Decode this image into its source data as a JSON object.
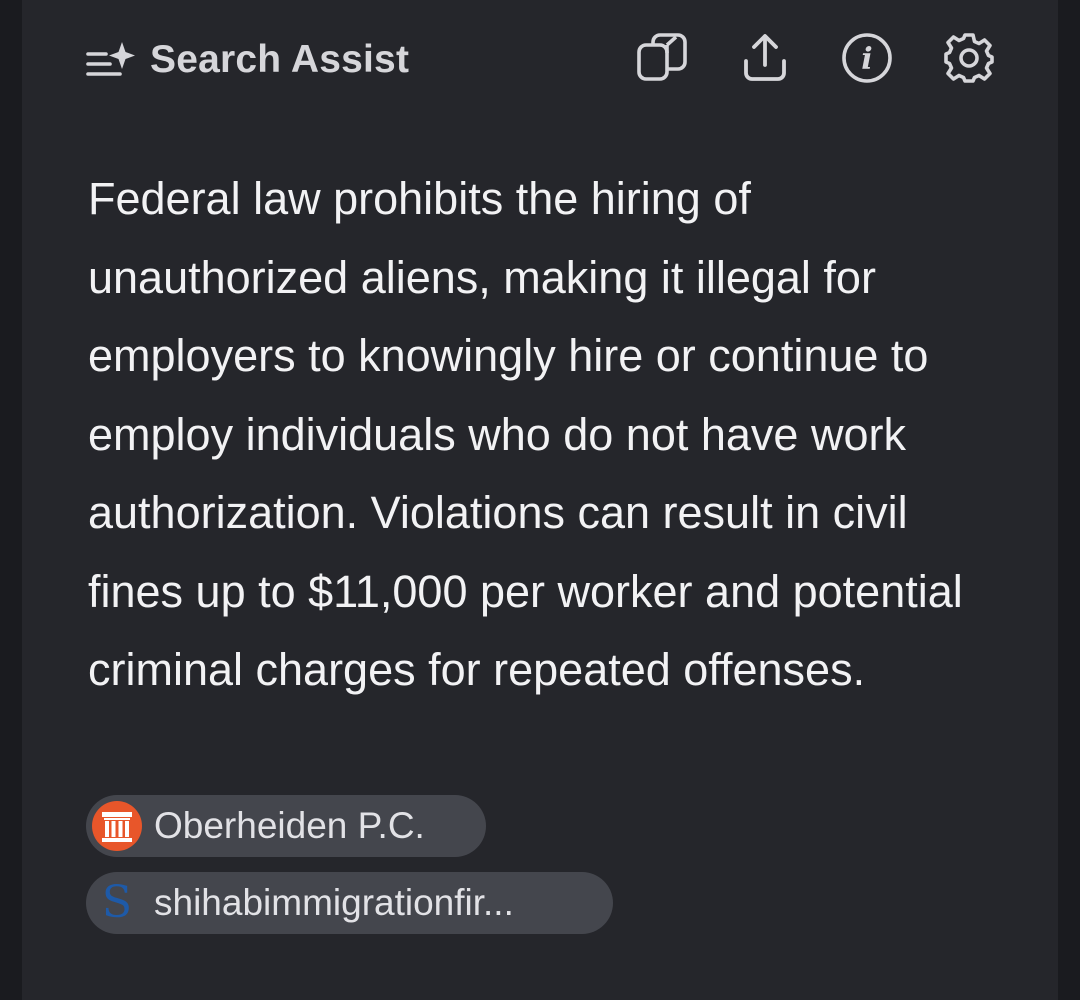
{
  "header": {
    "title": "Search Assist",
    "title_icon": "sparkle-list-icon",
    "actions": [
      {
        "icon": "copy-icon"
      },
      {
        "icon": "share-icon"
      },
      {
        "icon": "info-icon"
      },
      {
        "icon": "settings-gear-icon"
      }
    ]
  },
  "answer": {
    "text": "Federal law prohibits the hiring of unauthorized aliens, making it illegal for employers to knowingly hire or continue to employ individuals who do not have work authorization. Violations can result in civil fines up to $11,000 per worker and potential criminal charges for repeated offenses."
  },
  "sources": [
    {
      "label": "Oberheiden P.C.",
      "icon": "columns-logo-icon",
      "icon_color": "#e8562a"
    },
    {
      "label": "shihabimmigrationfir...",
      "icon": "s-logo-icon",
      "icon_color": "#1e5aa8"
    }
  ],
  "colors": {
    "background": "#1a1b1f",
    "card": "#25262b",
    "chip": "#44464d",
    "text": "#f2f2f4",
    "icon": "#d6d6da"
  }
}
